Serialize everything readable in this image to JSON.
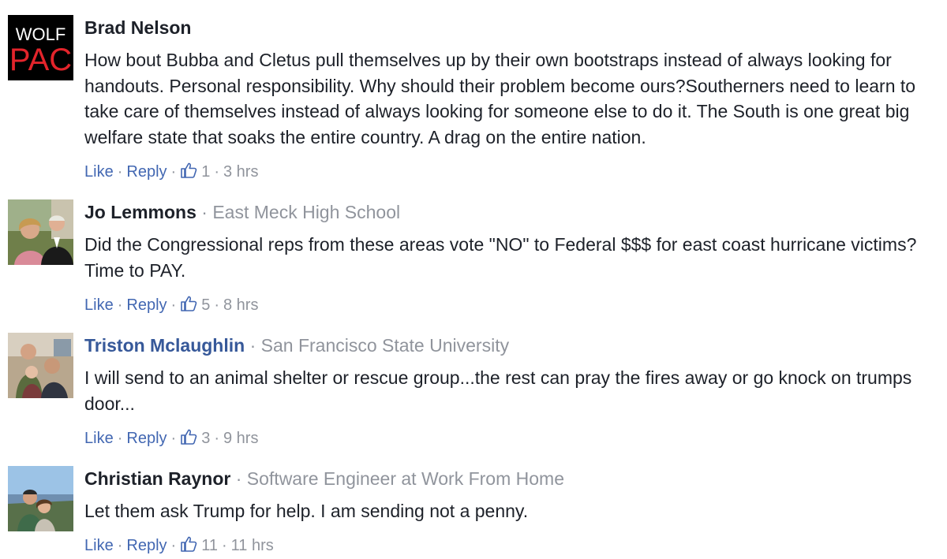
{
  "comments": [
    {
      "author": "Brad Nelson",
      "author_is_link": false,
      "affiliation": "",
      "avatar": {
        "type": "logo",
        "line1": "WOLF",
        "line2": "PAC",
        "bg": "#000000",
        "line1_color": "#ffffff",
        "line2_color": "#e3242b"
      },
      "text": "How bout Bubba and Cletus pull themselves up by their own bootstraps instead of always looking for handouts. Personal responsibility. Why should their problem become ours?Southerners need to learn to take care of themselves instead of always looking for someone else to do it. The South is one great big welfare state that soaks the entire country. A drag on the entire nation.",
      "like_label": "Like",
      "reply_label": "Reply",
      "likes": "1",
      "time": "3 hrs"
    },
    {
      "author": "Jo Lemmons",
      "author_is_link": false,
      "affiliation": "East Meck High School",
      "avatar": {
        "type": "photo",
        "scene": "couple-formal"
      },
      "text": "Did the Congressional reps from these areas vote \"NO\" to Federal $$$ for east coast hurricane victims? Time to PAY.",
      "like_label": "Like",
      "reply_label": "Reply",
      "likes": "5",
      "time": "8 hrs"
    },
    {
      "author": "Triston Mclaughlin",
      "author_is_link": true,
      "affiliation": "San Francisco State University",
      "avatar": {
        "type": "photo",
        "scene": "family-indoor"
      },
      "text": "I will send to an animal shelter or rescue group...the rest can pray the fires away or go knock on trumps door...",
      "like_label": "Like",
      "reply_label": "Reply",
      "likes": "3",
      "time": "9 hrs"
    },
    {
      "author": "Christian Raynor",
      "author_is_link": false,
      "affiliation": "Software Engineer at Work From Home",
      "avatar": {
        "type": "photo",
        "scene": "couple-outdoor"
      },
      "text": "Let them ask Trump for help. I am sending not a penny.",
      "like_label": "Like",
      "reply_label": "Reply",
      "likes": "11",
      "time": "11 hrs"
    }
  ],
  "colors": {
    "name": "#1d2129",
    "name_link": "#365899",
    "meta": "#90949c",
    "action": "#4267b2"
  },
  "separator": "·"
}
